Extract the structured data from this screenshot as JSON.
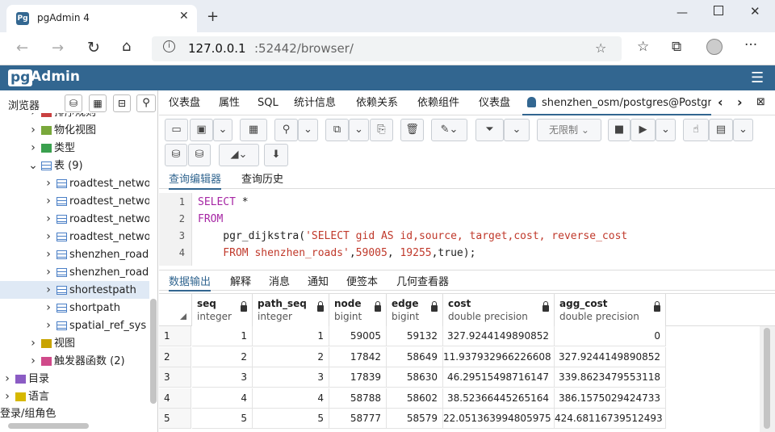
{
  "browser": {
    "tab_title": "pgAdmin 4",
    "tab_icon_text": "Pg",
    "url_host": "127.0.0.1",
    "url_rest": ":52442/browser/"
  },
  "header": {
    "logo_pg": "pg",
    "logo_admin": "Admin"
  },
  "left": {
    "title": "浏览器",
    "tree": [
      {
        "label": "排序规则",
        "expand": ">",
        "depth": 1,
        "icon": "collation-icon",
        "partial": true
      },
      {
        "label": "物化视图",
        "expand": ">",
        "depth": 1,
        "icon": "materialized-view-icon"
      },
      {
        "label": "类型",
        "expand": ">",
        "depth": 1,
        "icon": "type-icon"
      },
      {
        "label": "表 (9)",
        "expand": "v",
        "depth": 1,
        "icon": "table-icon"
      },
      {
        "label": "roadtest_networ",
        "expand": ">",
        "depth": 2,
        "icon": "table-icon"
      },
      {
        "label": "roadtest_networ",
        "expand": ">",
        "depth": 2,
        "icon": "table-icon"
      },
      {
        "label": "roadtest_networ",
        "expand": ">",
        "depth": 2,
        "icon": "table-icon"
      },
      {
        "label": "roadtest_networ",
        "expand": ">",
        "depth": 2,
        "icon": "table-icon"
      },
      {
        "label": "shenzhen_roads",
        "expand": ">",
        "depth": 2,
        "icon": "table-icon"
      },
      {
        "label": "shenzhen_roads",
        "expand": ">",
        "depth": 2,
        "icon": "table-icon"
      },
      {
        "label": "shortestpath",
        "expand": ">",
        "depth": 2,
        "icon": "table-icon",
        "selected": true
      },
      {
        "label": "shortpath",
        "expand": ">",
        "depth": 2,
        "icon": "table-icon"
      },
      {
        "label": "spatial_ref_sys",
        "expand": ">",
        "depth": 2,
        "icon": "table-icon"
      },
      {
        "label": "视图",
        "expand": ">",
        "depth": 1,
        "icon": "view-icon"
      },
      {
        "label": "触发器函数 (2)",
        "expand": ">",
        "depth": 1,
        "icon": "trigger-function-icon"
      },
      {
        "label": "目录",
        "expand": ">",
        "depth": 0,
        "icon": "catalog-icon"
      },
      {
        "label": "语言",
        "expand": ">",
        "depth": 0,
        "icon": "language-icon"
      },
      {
        "label": "登录/组角色",
        "expand": "",
        "depth": -1,
        "icon": "",
        "partial": true
      }
    ]
  },
  "tabs": [
    "仪表盘",
    "属性",
    "SQL",
    "统计信息",
    "依赖关系",
    "依赖组件",
    "仪表盘"
  ],
  "active_tab": "shenzhen_osm/postgres@Postgr",
  "toolbar": {
    "limit": "无限制"
  },
  "editor_tabs": [
    "查询编辑器",
    "查询历史"
  ],
  "code": {
    "line_numbers": [
      "1",
      "2",
      "3",
      "4"
    ],
    "line1_kw": "SELECT",
    "line1_rest": " *",
    "line2_kw": "FROM",
    "line3_pre": "    pgr_dijkstra(",
    "line3_str": "'SELECT gid AS id,source, target,cost, reverse_cost",
    "line4_str": "    FROM shenzhen_roads'",
    "line4_sep1": ",",
    "line4_num1": "59005",
    "line4_sep2": ", ",
    "line4_num2": "19255",
    "line4_end": ",true);"
  },
  "output_tabs": [
    "数据输出",
    "解释",
    "消息",
    "通知",
    "便签本",
    "几何查看器"
  ],
  "grid": {
    "columns": [
      {
        "name": "seq",
        "type": "integer"
      },
      {
        "name": "path_seq",
        "type": "integer"
      },
      {
        "name": "node",
        "type": "bigint"
      },
      {
        "name": "edge",
        "type": "bigint"
      },
      {
        "name": "cost",
        "type": "double precision"
      },
      {
        "name": "agg_cost",
        "type": "double precision"
      }
    ],
    "rows": [
      [
        "1",
        "1",
        "1",
        "59005",
        "59132",
        "327.9244149890852",
        "0"
      ],
      [
        "2",
        "2",
        "2",
        "17842",
        "58649",
        "11.937932966226608",
        "327.9244149890852"
      ],
      [
        "3",
        "3",
        "3",
        "17839",
        "58630",
        "46.29515498716147",
        "339.8623479553118"
      ],
      [
        "4",
        "4",
        "4",
        "58788",
        "58602",
        "38.52366445265164",
        "386.1575029424733"
      ],
      [
        "5",
        "5",
        "5",
        "58777",
        "58579",
        "22.051363994805975",
        "424.68116739512493"
      ]
    ]
  }
}
